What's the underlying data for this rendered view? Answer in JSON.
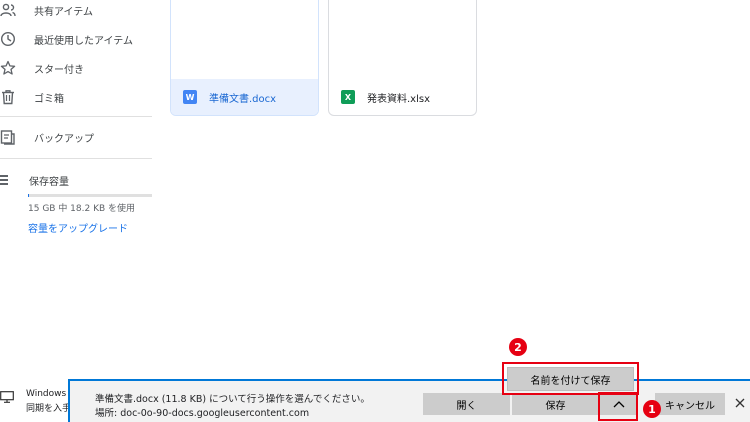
{
  "sidebar": {
    "items": [
      {
        "label": "共有アイテム",
        "icon": "people-icon"
      },
      {
        "label": "最近使用したアイテム",
        "icon": "clock-icon"
      },
      {
        "label": "スター付き",
        "icon": "star-icon"
      },
      {
        "label": "ゴミ箱",
        "icon": "trash-icon"
      },
      {
        "label": "バックアップ",
        "icon": "backup-icon"
      }
    ],
    "storage": {
      "label": "保存容量",
      "usage_text": "15 GB 中 18.2 KB を使用",
      "used_fraction": 1e-06,
      "upgrade_label": "容量をアップグレード"
    }
  },
  "files": [
    {
      "name": "準備文書.docx",
      "type_letter": "W",
      "color": "#4285f4",
      "selected": true
    },
    {
      "name": "発表資料.xlsx",
      "type_letter": "X",
      "color": "#0f9d58",
      "selected": false
    }
  ],
  "taskbar": {
    "line1": "Windows",
    "line2": "同期を入手"
  },
  "download_bar": {
    "message": "準備文書.docx (11.8 KB) について行う操作を選んでください。",
    "location": "場所: doc-0o-90-docs.googleusercontent.com",
    "open_label": "開く",
    "save_label": "保存",
    "cancel_label": "キャンセル",
    "save_as_label": "名前を付けて保存"
  },
  "callouts": {
    "badge_1": "1",
    "badge_2": "2"
  },
  "colors": {
    "accent": "#1a73e8",
    "download_border": "#0078d7",
    "highlight": "#e60012"
  }
}
